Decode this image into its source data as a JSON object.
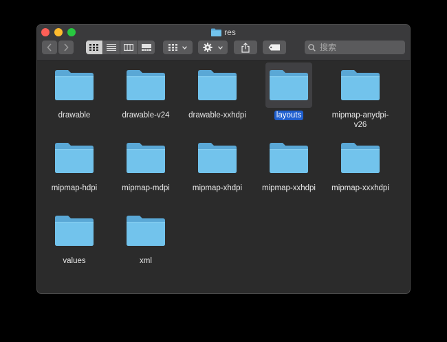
{
  "window": {
    "title": "res"
  },
  "toolbar": {
    "back_icon": "chevron-left-icon",
    "forward_icon": "chevron-right-icon",
    "view_modes": [
      "icon-view",
      "list-view",
      "column-view",
      "gallery-view"
    ],
    "active_view": "icon-view",
    "group_icon": "grid-icon",
    "action_icon": "gear-icon",
    "share_icon": "share-icon",
    "tag_icon": "tag-icon"
  },
  "search": {
    "placeholder": "搜索"
  },
  "colors": {
    "folder_light": "#72c3ec",
    "folder_dark": "#5aa8d6",
    "selection": "#1f5fcf",
    "window_bg": "#2b2b2b"
  },
  "files": [
    {
      "name": "drawable",
      "selected": false
    },
    {
      "name": "drawable-v24",
      "selected": false
    },
    {
      "name": "drawable-xxhdpi",
      "selected": false
    },
    {
      "name": "layouts",
      "selected": true
    },
    {
      "name": "mipmap-anydpi-v26",
      "selected": false
    },
    {
      "name": "mipmap-hdpi",
      "selected": false
    },
    {
      "name": "mipmap-mdpi",
      "selected": false
    },
    {
      "name": "mipmap-xhdpi",
      "selected": false
    },
    {
      "name": "mipmap-xxhdpi",
      "selected": false
    },
    {
      "name": "mipmap-xxxhdpi",
      "selected": false
    },
    {
      "name": "values",
      "selected": false
    },
    {
      "name": "xml",
      "selected": false
    }
  ]
}
